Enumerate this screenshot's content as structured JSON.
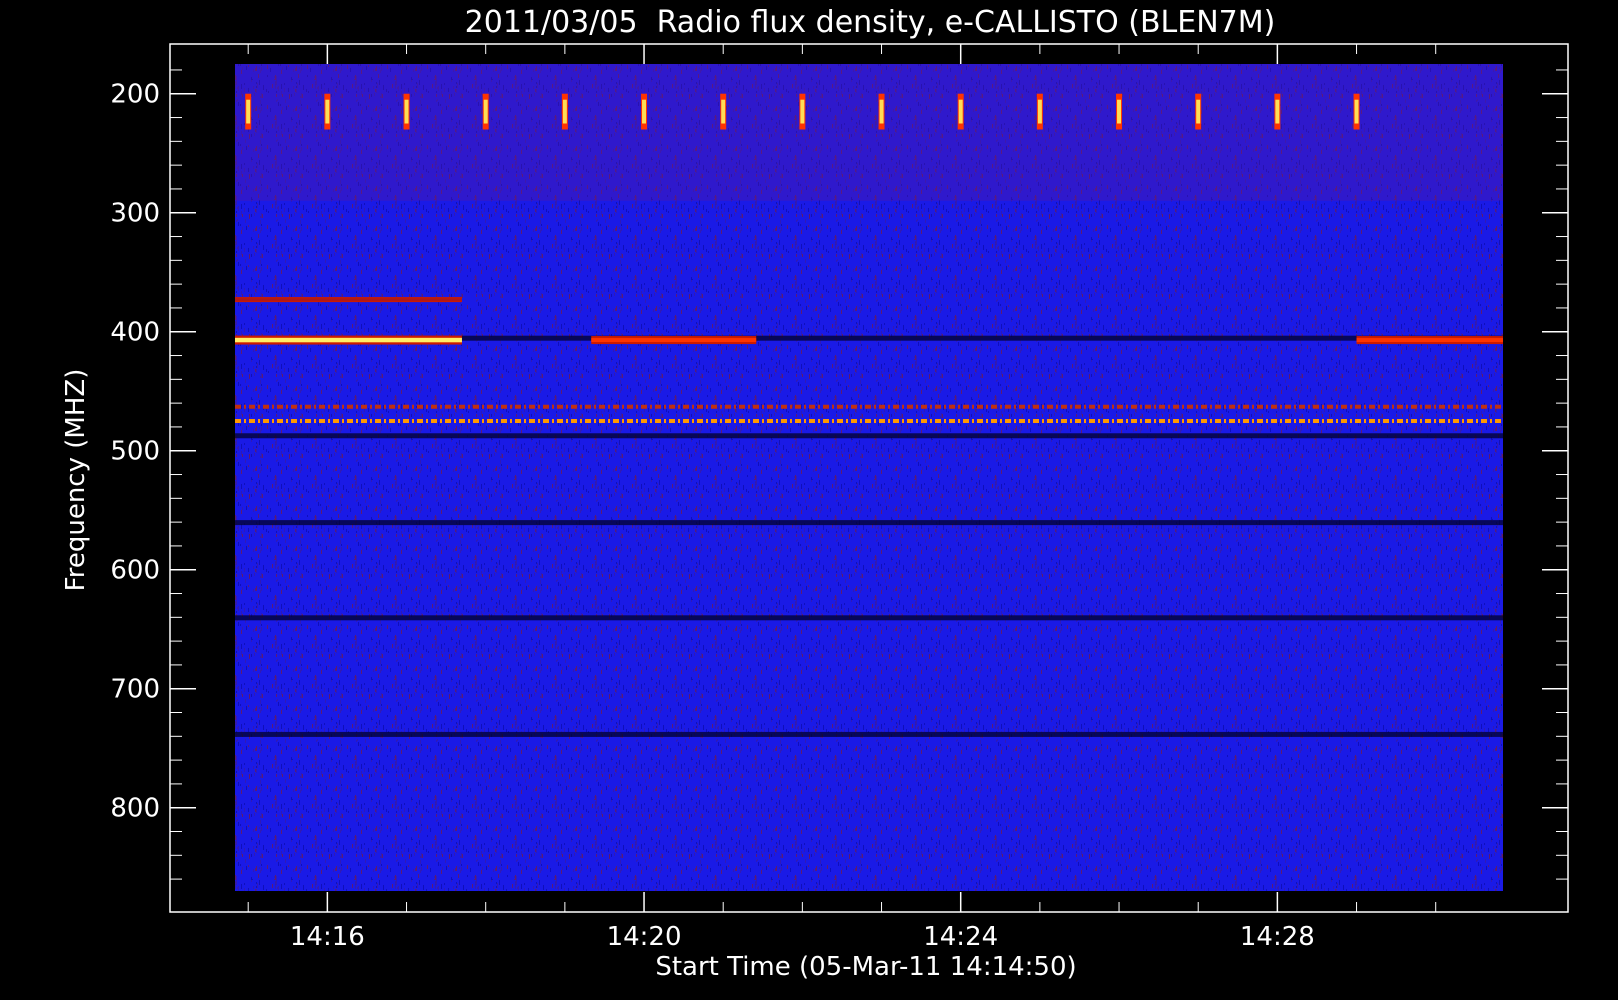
{
  "chart_data": {
    "type": "heatmap",
    "title": "2011/03/05  Radio flux density, e-CALLISTO (BLEN7M)",
    "xlabel": "Start Time (05-Mar-11 14:14:50)",
    "ylabel": "Frequency (MHZ)",
    "x_ticks": [
      "14:16",
      "14:20",
      "14:24",
      "14:28"
    ],
    "y_ticks": [
      200,
      300,
      400,
      500,
      600,
      700,
      800
    ],
    "xlim": [
      "14:14:50",
      "14:30:51"
    ],
    "ylim": [
      870,
      175
    ],
    "y_axis_inverted": true,
    "grid": false,
    "colormap": "blue-red-yellow-white",
    "background_color": "#000000",
    "axis_color": "#ffffff",
    "low_intensity_color": "#1a1ae6",
    "features": {
      "continuous_bands_mhz": [
        {
          "freq": 407,
          "start": "14:14:50",
          "end": "14:17:42",
          "level": "very-high"
        },
        {
          "freq": 407,
          "start": "14:19:20",
          "end": "14:21:25",
          "level": "high"
        },
        {
          "freq": 407,
          "start": "14:29:00",
          "end": "14:30:51",
          "level": "high"
        },
        {
          "freq": 373,
          "start": "14:14:50",
          "end": "14:17:42",
          "level": "medium"
        },
        {
          "freq": 475,
          "start": "14:14:50",
          "end": "14:30:51",
          "level": "high-dashed"
        },
        {
          "freq": 463,
          "start": "14:14:50",
          "end": "14:30:51",
          "level": "medium-dashed"
        }
      ],
      "dark_bands_mhz": [
        405,
        487,
        560,
        640,
        738
      ],
      "periodic_spikes": {
        "freq_range": [
          205,
          225
        ],
        "start": "14:15:00",
        "period_min": 1.0,
        "count": 15
      }
    }
  }
}
